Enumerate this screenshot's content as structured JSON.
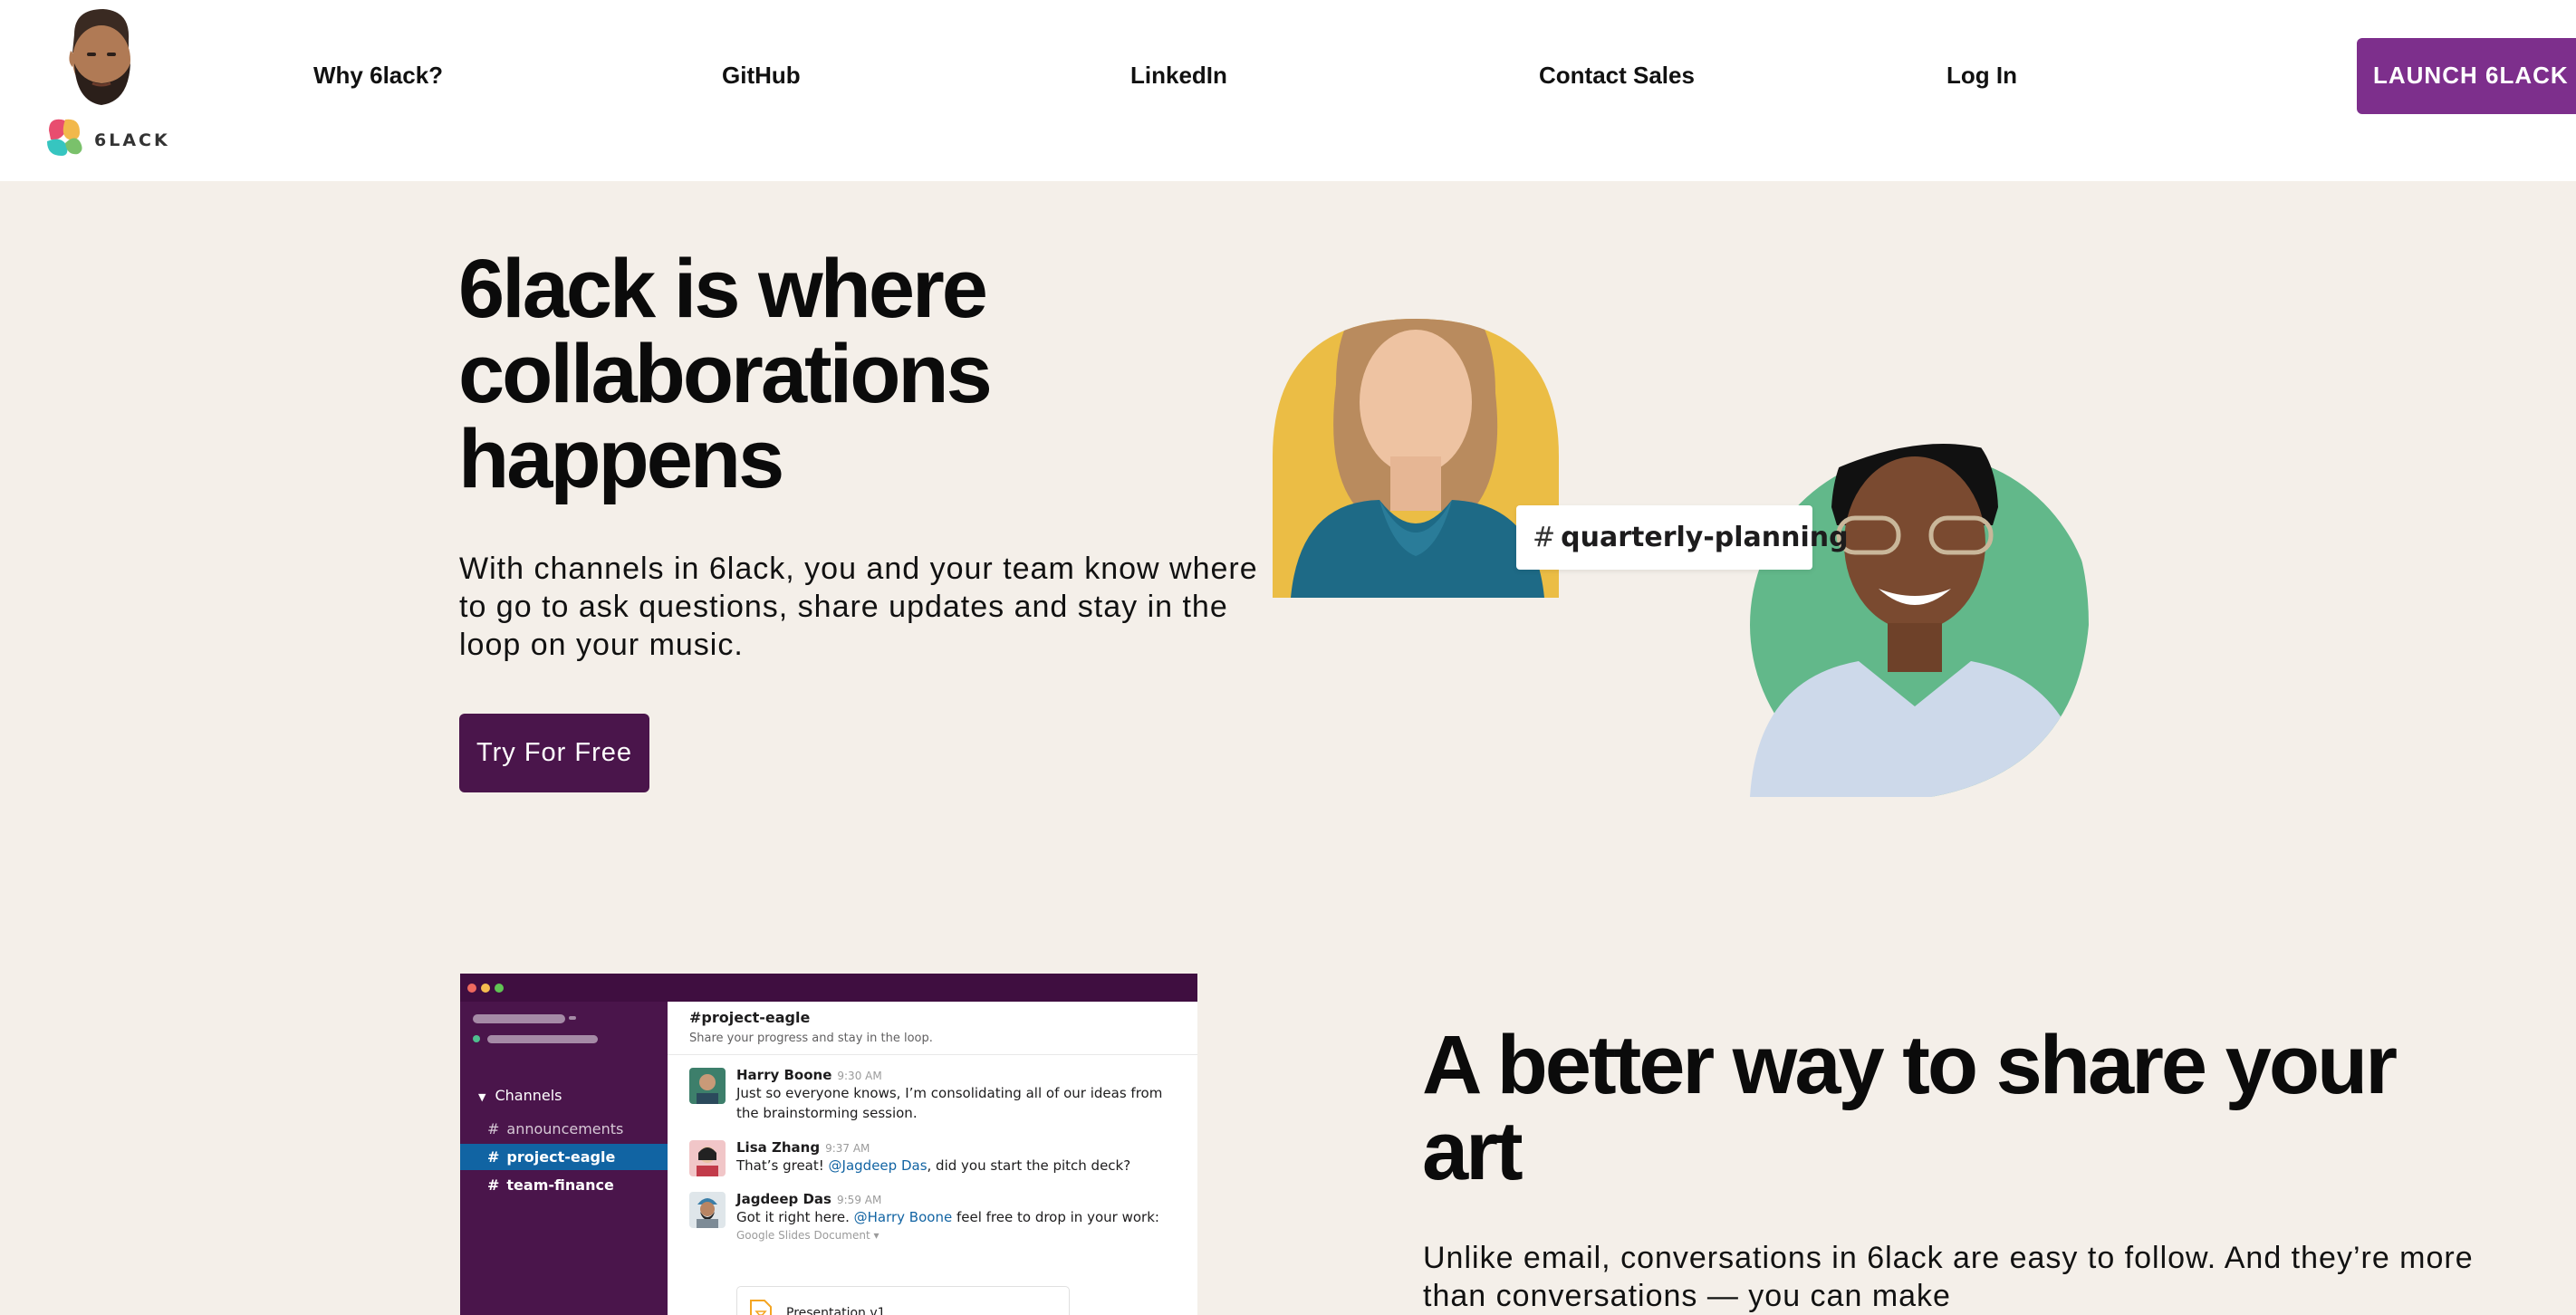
{
  "nav": {
    "logo_text": "6LACK",
    "links": [
      "Why 6lack?",
      "GitHub",
      "LinkedIn",
      "Contact Sales",
      "Log In"
    ],
    "launch_label": "LAUNCH 6LACK"
  },
  "hero": {
    "title": "6lack is where collaborations happens",
    "subtitle": "With channels in 6lack, you and your team know where to go to ask questions, share updates and stay in the loop on your music.",
    "cta_label": "Try For Free",
    "channel_tag": "quarterly-planning"
  },
  "app_mockup": {
    "sidebar": {
      "section_label": "Channels",
      "channels": [
        "announcements",
        "project-eagle",
        "team-finance"
      ],
      "active_channel": "project-eagle"
    },
    "channel_title": "#project-eagle",
    "channel_description": "Share your progress and stay in the loop.",
    "messages": [
      {
        "name": "Harry Boone",
        "time": "9:30 AM",
        "text": "Just so everyone knows, I’m consolidating all of our ideas from the brainstorming session."
      },
      {
        "name": "Lisa Zhang",
        "time": "9:37 AM",
        "text_before": "That’s great! ",
        "mention": "@Jagdeep Das",
        "text_after": ", did you start the pitch deck?"
      },
      {
        "name": "Jagdeep Das",
        "time": "9:59 AM",
        "text_before": "Got it right here. ",
        "mention": "@Harry Boone",
        "text_after": " feel free to drop in your work:",
        "attachment_type": "Google Slides Document",
        "attachment_name": "Presentation v1"
      }
    ]
  },
  "section2": {
    "title": "A better way to share your art",
    "subtitle": "Unlike email, conversations in 6lack are easy to follow. And they’re more than conversations — you can make"
  },
  "colors": {
    "page_bg": "#f4efe9",
    "launch_button": "#7d2f8c",
    "cta_button": "#4a154b",
    "sidebar_bg": "#4a154b",
    "active_channel": "#1164a3",
    "photo1_circle": "#ebbd45",
    "photo2_circle": "#62b88a"
  }
}
